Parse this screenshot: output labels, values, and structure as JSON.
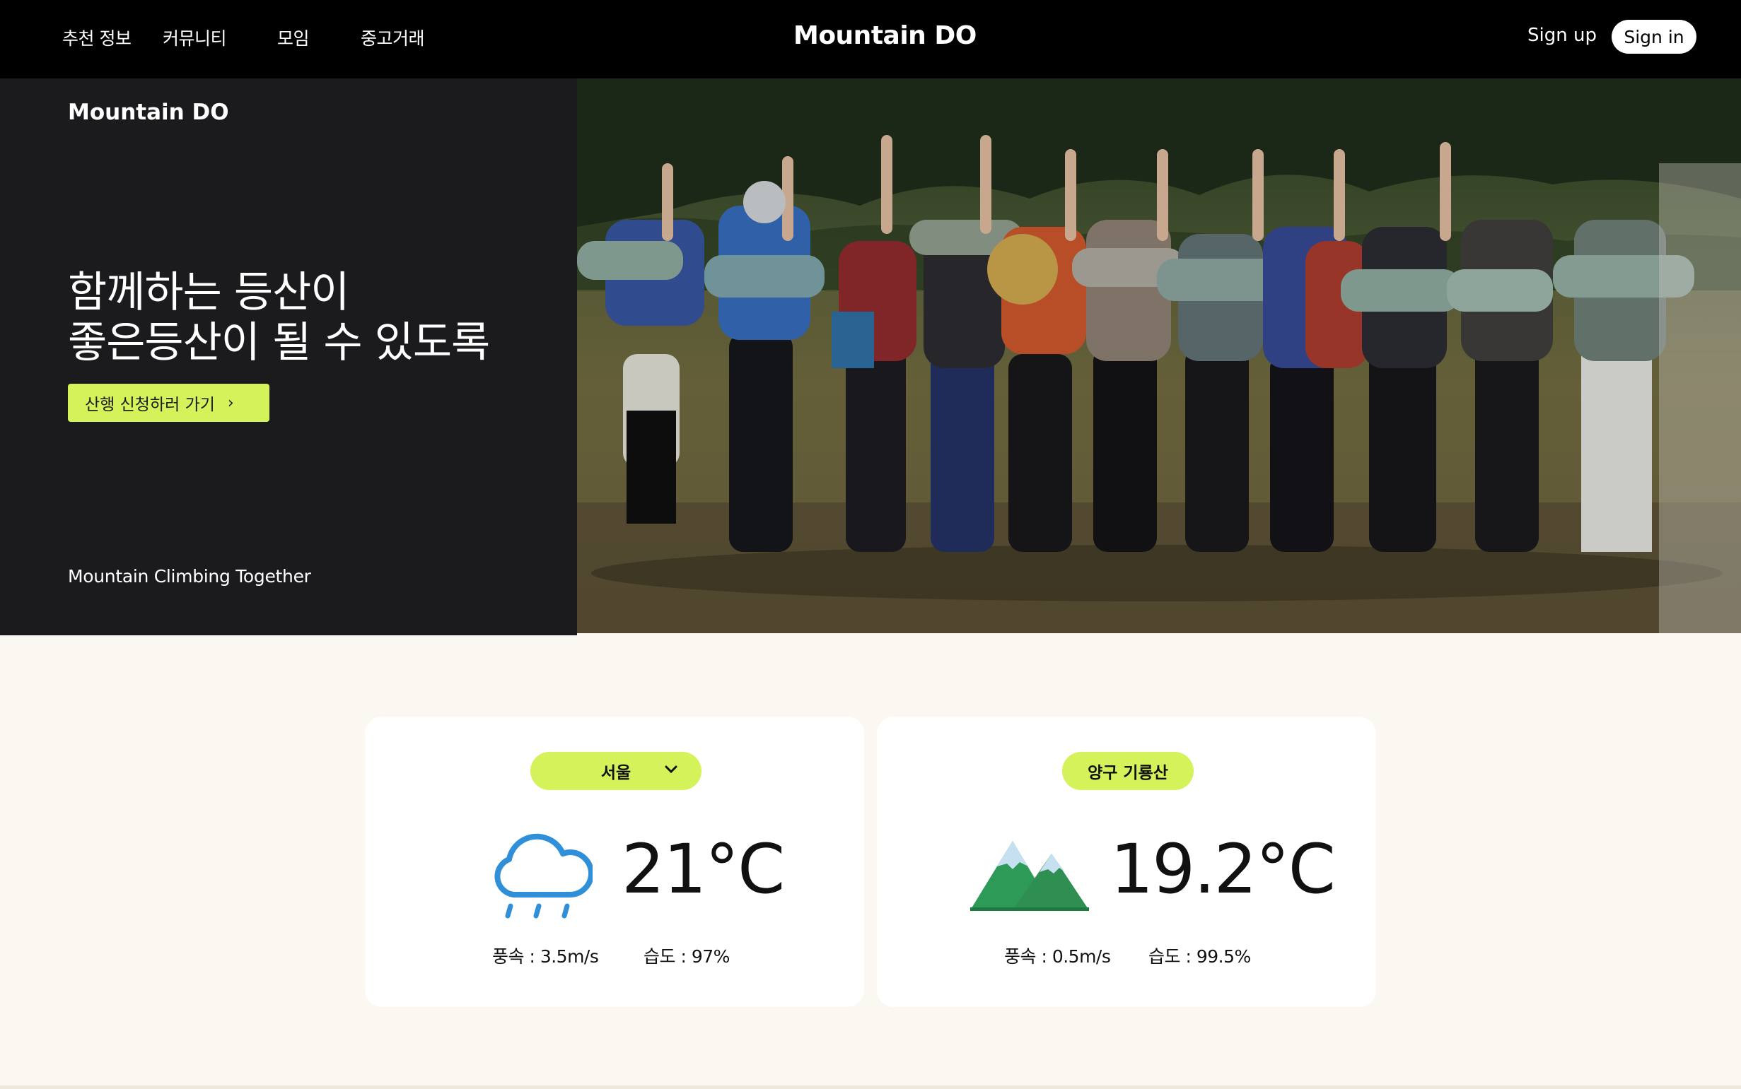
{
  "nav": {
    "items": [
      "추천 정보",
      "커뮤니티",
      "모임",
      "중고거래"
    ],
    "brand": "Mountain DO",
    "sign_up": "Sign up",
    "sign_in": "Sign in"
  },
  "hero": {
    "brand": "Mountain DO",
    "headline_line1": "함께하는 등산이",
    "headline_line2": "좋은등산이 될 수 있도록",
    "cta_label": "산행 신청하러 가기",
    "tagline": "Mountain Climbing Together"
  },
  "weather": [
    {
      "location": "서울",
      "icon": "rain-cloud-icon",
      "temperature": "21°C",
      "wind": "풍속 : 3.5m/s",
      "humidity": "습도 : 97%"
    },
    {
      "location": "양구 기룡산",
      "icon": "mountain-icon",
      "temperature": "19.2°C",
      "wind": "풍속 : 0.5m/s",
      "humidity": "습도 : 99.5%"
    }
  ],
  "colors": {
    "accent": "#d4f25a",
    "nav_bg": "#000000",
    "hero_bg": "#1b1a1d",
    "page_bg": "#fbf8f2",
    "rain_icon": "#2f8fd8",
    "mountain_green": "#2e9a57"
  }
}
